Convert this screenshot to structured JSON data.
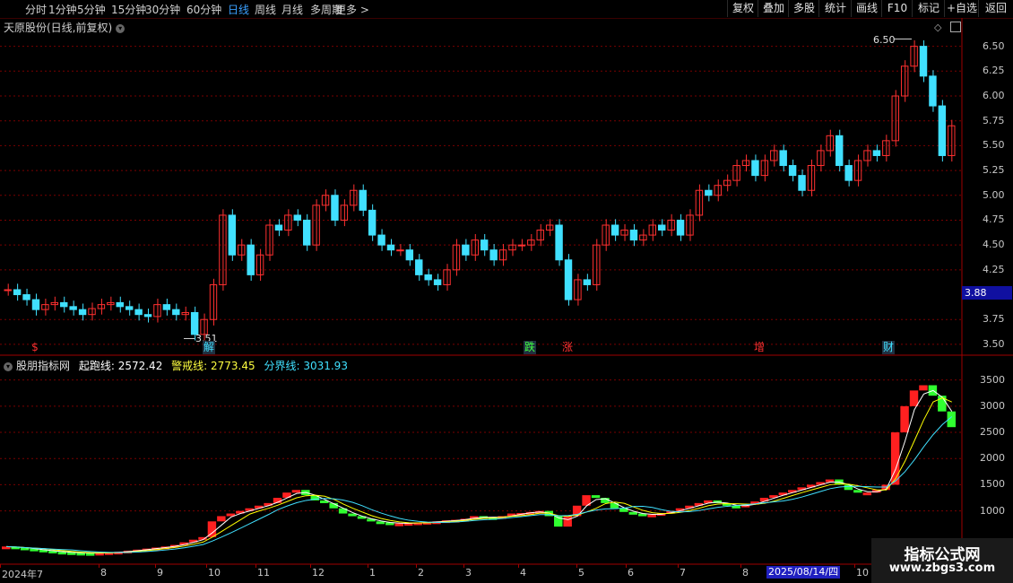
{
  "toolbar": {
    "periods": [
      "分时",
      "1分钟",
      "5分钟",
      "15分钟",
      "30分钟",
      "60分钟",
      "日线",
      "周线",
      "月线",
      "多周期",
      "更多 >"
    ],
    "active_period": "日线",
    "right_buttons": [
      "复权",
      "叠加",
      "多股",
      "统计",
      "画线",
      "F10",
      "标记",
      "+自选",
      "返回"
    ]
  },
  "stock_title": "天原股份(日线,前复权)",
  "indicator": {
    "name": "股朋指标网",
    "line1": "起跑线: 2572.42",
    "line2": "警戒线: 2773.45",
    "line3": "分界线: 3031.93",
    "colors": {
      "line1": "#ffffff",
      "line2": "#ffff00",
      "line3": "#40e0ff"
    }
  },
  "price_axis": [
    "6.50",
    "6.25",
    "6.00",
    "5.75",
    "5.50",
    "5.25",
    "5.00",
    "4.75",
    "4.50",
    "4.25",
    "3.75",
    "3.50"
  ],
  "current_price": "3.88",
  "indicator_axis": [
    "3500",
    "3000",
    "2500",
    "2000",
    "1500",
    "1000"
  ],
  "annotations": {
    "high": "6.50",
    "low": "3.51"
  },
  "events": [
    {
      "label": "$",
      "color": "#ff3030"
    },
    {
      "label": "解",
      "color": "#40e0ff"
    },
    {
      "label": "跌",
      "color": "#40ff40"
    },
    {
      "label": "涨",
      "color": "#ff3030"
    },
    {
      "label": "增",
      "color": "#ff3030"
    },
    {
      "label": "财",
      "color": "#40e0ff"
    }
  ],
  "x_axis": [
    "2024年7",
    "8",
    "9",
    "10",
    "11",
    "12",
    "1",
    "2",
    "3",
    "4",
    "5",
    "6",
    "7",
    "8",
    "10"
  ],
  "cursor_date": "2025/08/14/四",
  "watermark": {
    "line1": "指标公式网",
    "line2": "www.zbgs3.com"
  },
  "colors": {
    "up": "#ff3030",
    "down": "#40e0ff",
    "grid": "#800000",
    "bg": "#000000"
  },
  "chart_data": {
    "type": "candlestick",
    "price_ylim": [
      3.4,
      6.65
    ],
    "close_series": [
      4.05,
      4.0,
      3.95,
      3.85,
      3.9,
      3.92,
      3.88,
      3.85,
      3.8,
      3.86,
      3.9,
      3.92,
      3.88,
      3.85,
      3.8,
      3.78,
      3.9,
      3.85,
      3.8,
      3.82,
      3.6,
      3.75,
      4.1,
      4.8,
      4.4,
      4.5,
      4.2,
      4.4,
      4.7,
      4.65,
      4.8,
      4.75,
      4.5,
      4.9,
      5.0,
      4.75,
      4.9,
      5.05,
      4.85,
      4.6,
      4.5,
      4.45,
      4.45,
      4.35,
      4.2,
      4.15,
      4.1,
      4.25,
      4.5,
      4.4,
      4.55,
      4.45,
      4.35,
      4.45,
      4.5,
      4.5,
      4.55,
      4.65,
      4.7,
      4.35,
      3.95,
      4.15,
      4.1,
      4.5,
      4.7,
      4.6,
      4.65,
      4.55,
      4.6,
      4.7,
      4.65,
      4.75,
      4.6,
      4.8,
      5.05,
      5.0,
      5.1,
      5.15,
      5.3,
      5.35,
      5.2,
      5.35,
      5.45,
      5.3,
      5.2,
      5.05,
      5.3,
      5.45,
      5.6,
      5.3,
      5.15,
      5.35,
      5.45,
      5.4,
      5.55,
      6.0,
      6.3,
      6.5,
      6.2,
      5.9,
      5.4,
      5.7
    ],
    "indicator_ylim": [
      0,
      3700
    ],
    "indicator_series": [
      320,
      300,
      280,
      260,
      240,
      220,
      210,
      200,
      195,
      190,
      200,
      210,
      220,
      240,
      260,
      280,
      300,
      320,
      350,
      400,
      450,
      500,
      800,
      900,
      950,
      1000,
      1050,
      1100,
      1150,
      1250,
      1350,
      1400,
      1300,
      1200,
      1150,
      1050,
      950,
      900,
      850,
      800,
      780,
      760,
      760,
      770,
      780,
      790,
      800,
      820,
      830,
      850,
      900,
      880,
      860,
      900,
      950,
      960,
      980,
      1000,
      900,
      700,
      900,
      1100,
      1300,
      1250,
      1150,
      1050,
      980,
      950,
      920,
      930,
      960,
      1000,
      1050,
      1100,
      1150,
      1200,
      1150,
      1100,
      1080,
      1120,
      1180,
      1250,
      1300,
      1350,
      1400,
      1450,
      1500,
      1550,
      1600,
      1500,
      1400,
      1350,
      1350,
      1400,
      1500,
      2500,
      3000,
      3300,
      3400,
      3200,
      2900,
      2600
    ]
  }
}
